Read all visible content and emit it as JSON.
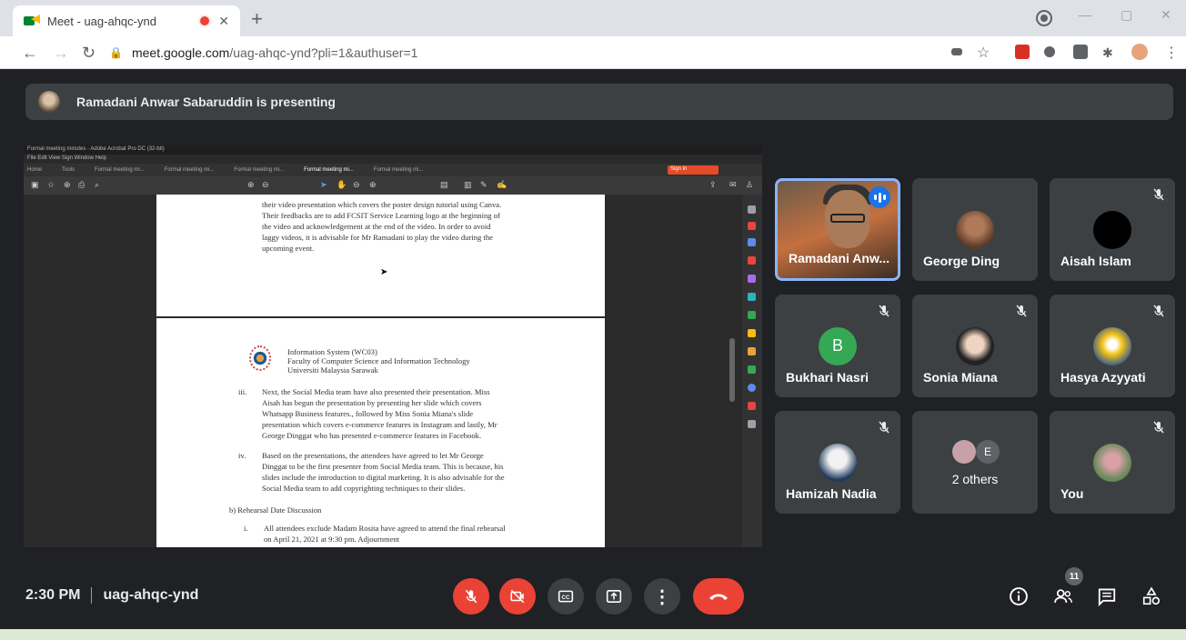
{
  "browser": {
    "tab_title": "Meet - uag-ahqc-ynd",
    "url_host": "meet.google.com",
    "url_path": "/uag-ahqc-ynd?pli=1&authuser=1"
  },
  "banner": {
    "text": "Ramadani Anwar Sabaruddin is presenting"
  },
  "pdf": {
    "window_title": "Formal meeting minutes - Adobe Acrobat Pro DC (32-bit)",
    "menu": "File  Edit  View  Sign  Window  Help",
    "tabs": [
      "Home",
      "Tools",
      "Formal meeting mi...",
      "Formal meeting mi...",
      "Formal meeting mi...",
      "Formal meeting mi...",
      "Formal meeting mi..."
    ],
    "sign_label": "Sign in",
    "page1_lines": [
      "their video presentation which covers the poster design tutorial using Canva.",
      "Their feedbacks are to add FCSIT Service Learning logo at the beginning of",
      "the video and acknowledgement at the end of the video. In order to avoid",
      "laggy videos, it is advisable for Mr Ramadani to play the video during the",
      "upcoming event."
    ],
    "header_lines": [
      "Information System (WC03)",
      "Faculty of Computer Science and Information Technology",
      "Universiti Malaysia Sarawak"
    ],
    "item_iii_marker": "iii.",
    "item_iii_lines": [
      "Next, the Social Media team have also presented their presentation. Miss",
      "Aisah has begun the presentation by presenting her slide which covers",
      "Whatsapp Business features., followed by Miss Sonia Miana's slide",
      "presentation which covers e-commerce features in Instagram and lastly, Mr",
      "George Dinggat who has presented e-commerce features in Facebook."
    ],
    "item_iv_marker": "iv.",
    "item_iv_lines": [
      "Based on the presentations, the attendees have agreed to let Mr George",
      "Dinggat to be the first presenter from Social Media team. This is because, his",
      "slides include the introduction to digital marketing. It is also advisable for the",
      "Social Media team to add copyrighting techniques to their slides."
    ],
    "section_b": "b)  Rehearsal Date Discussion",
    "item_i_marker": "i.",
    "item_i_lines": [
      "All attendees exclude Madam Rosita have agreed to attend the final rehearsal",
      "on April 21, 2021 at 9:30 pm. Adjournment"
    ]
  },
  "participants": [
    {
      "name": "Ramadani Anw...",
      "muted": false,
      "speaking": true
    },
    {
      "name": "George Ding",
      "muted": false
    },
    {
      "name": "Aisah Islam",
      "muted": true
    },
    {
      "name": "Bukhari Nasri",
      "muted": true,
      "initial": "B"
    },
    {
      "name": "Sonia Miana",
      "muted": true
    },
    {
      "name": "Hasya Azyyati",
      "muted": true
    },
    {
      "name": "Hamizah Nadia",
      "muted": true
    },
    {
      "name": "2 others",
      "initial": "E"
    },
    {
      "name": "You",
      "muted": true
    }
  ],
  "bottom": {
    "time": "2:30 PM",
    "meeting_code": "uag-ahqc-ynd",
    "participant_count": "11"
  },
  "colors": {
    "red": "#ea4335",
    "tile": "#3c4043",
    "bg": "#202124",
    "active": "#8ab4f8",
    "bukhari": "#34a853"
  }
}
